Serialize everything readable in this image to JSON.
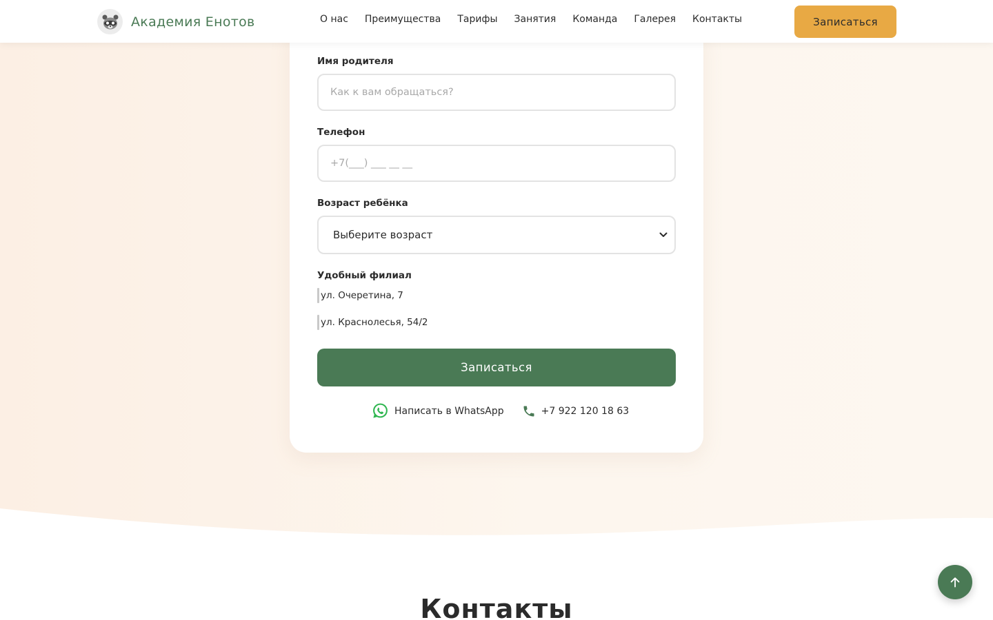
{
  "header": {
    "logo_text": "Академия Енотов",
    "logo_icon": "raccoon-icon",
    "nav": [
      "О нас",
      "Преимущества",
      "Тарифы",
      "Занятия",
      "Команда",
      "Галерея",
      "Контакты"
    ],
    "cta_label": "Записаться"
  },
  "form": {
    "parent_name": {
      "label": "Имя родителя",
      "placeholder": "Как к вам обращаться?"
    },
    "phone": {
      "label": "Телефон",
      "placeholder": "+7(___) ___ __ __"
    },
    "child_age": {
      "label": "Возраст ребёнка",
      "selected": "Выберите возраст"
    },
    "branch": {
      "label": "Удобный филиал",
      "options": [
        "ул. Очеретина, 7",
        "ул. Краснолесья, 54/2"
      ]
    },
    "submit_label": "Записаться",
    "whatsapp_label": "Написать в WhatsApp",
    "phone_number": "+7 922 120 18 63"
  },
  "contacts": {
    "title": "Контакты"
  },
  "colors": {
    "brand_green": "#4a7a55",
    "accent_orange": "#e8a944",
    "background_peach": "#fdf3ea"
  }
}
